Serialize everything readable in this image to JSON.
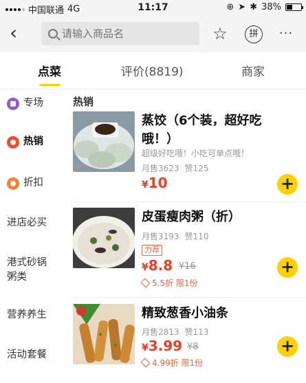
{
  "status_bar": {
    "carrier": "中国联通",
    "network": "4G",
    "time": "11:17",
    "battery_text": "38%",
    "battery_level": 0.38
  },
  "header": {
    "back_icon": "chevron-left-icon",
    "search_placeholder": "请输入商品名",
    "star_icon": "star-outline",
    "pin_label": "拼",
    "more_label": "···"
  },
  "tabs": [
    {
      "label": "点菜"
    },
    {
      "label": "评价(8819)"
    },
    {
      "label": "商家"
    }
  ],
  "sidebar": {
    "items": [
      {
        "label": "专场"
      },
      {
        "label": "热销"
      },
      {
        "label": "折扣"
      },
      {
        "label": "进店必买"
      },
      {
        "label": "港式砂锅粥类"
      },
      {
        "label": "营养养生"
      },
      {
        "label": "活动套餐"
      }
    ]
  },
  "section_title": "热销",
  "items": [
    {
      "name": "蒸饺（6个装，超好吃哦！）",
      "desc": "超级好吃哦！小吃可单点哦！",
      "sales": "月售3623",
      "likes": "赞125",
      "currency": "¥",
      "price": "10"
    },
    {
      "name": "皮蛋瘦肉粥（折）",
      "sales": "月售3193",
      "likes": "赞110",
      "tag": "力荐",
      "currency": "¥",
      "price": "8.8",
      "orig_price": "¥16",
      "discount": "5.5折 限1份"
    },
    {
      "name": "精致葱香小油条",
      "sales": "月售2813",
      "likes": "赞113",
      "currency": "¥",
      "price": "3.99",
      "orig_price": "¥8",
      "discount": "4.99折 限1份"
    }
  ],
  "colors": {
    "accent": "#ffd100",
    "price": "#f53b20"
  }
}
